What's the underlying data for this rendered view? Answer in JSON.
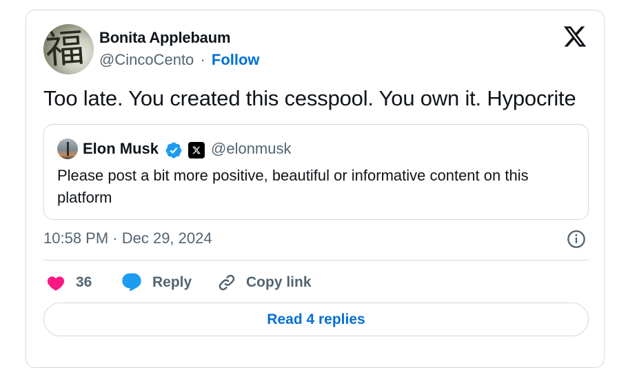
{
  "tweet": {
    "author": {
      "name": "Bonita Applebaum",
      "handle": "@CincoCento",
      "avatar_glyph": "福"
    },
    "separator": "·",
    "follow_label": "Follow",
    "text": "Too late. You created this cesspool. You own it. Hypocrite",
    "timestamp": "10:58 PM · Dec 29, 2024",
    "icons": {
      "platform_logo": "x-logo-icon",
      "info": "info-icon"
    }
  },
  "quoted_tweet": {
    "author": {
      "name": "Elon Musk",
      "handle": "@elonmusk",
      "verified_badge": "verified-badge-icon",
      "affiliation_badge": "x-affiliation-badge-icon"
    },
    "text": "Please post a bit more positive, beautiful or informative content on this platform"
  },
  "actions": {
    "like": {
      "count": "36",
      "icon": "heart-icon"
    },
    "reply": {
      "label": "Reply",
      "icon": "speech-bubble-icon"
    },
    "copy_link": {
      "label": "Copy link",
      "icon": "link-icon"
    }
  },
  "read_replies_label": "Read 4 replies",
  "colors": {
    "link_blue": "#006fd6",
    "verified_blue": "#1d9bf0",
    "like_pink": "#f91880",
    "muted_text": "#536471",
    "border": "#cfd9de"
  }
}
